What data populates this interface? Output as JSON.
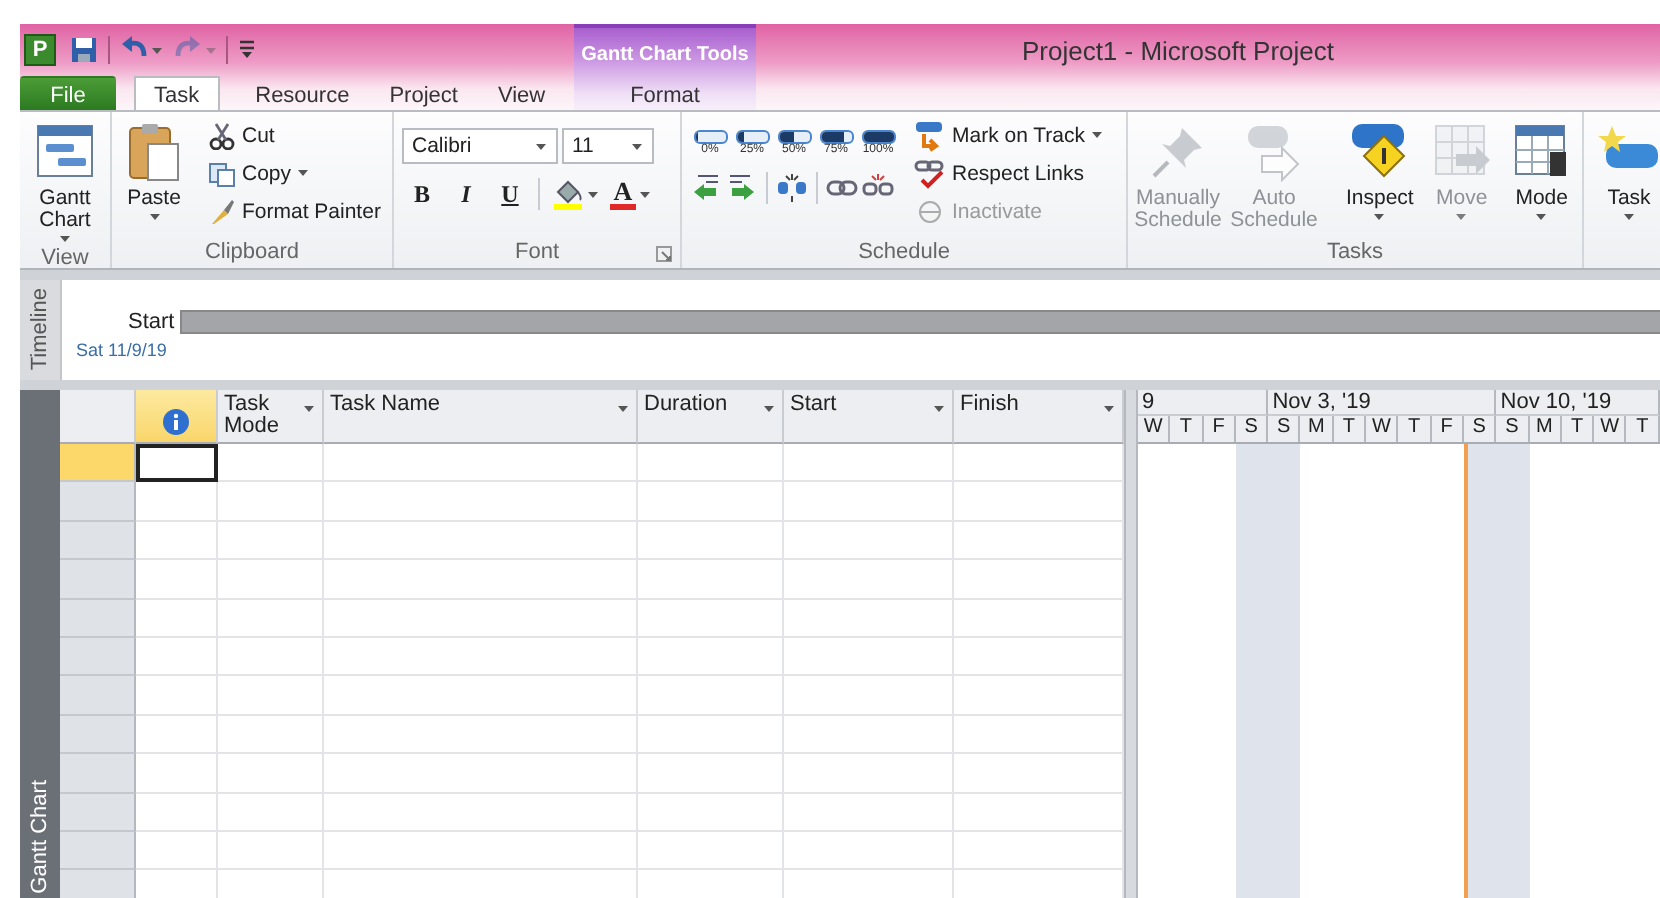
{
  "title_bar": {
    "app_icon": "P",
    "title": "Project1  -  Microsoft Project",
    "context_group": "Gantt Chart Tools"
  },
  "quick_access": [
    {
      "kind": "save",
      "disabled": false
    },
    {
      "kind": "undo",
      "disabled": false
    },
    {
      "kind": "redo",
      "disabled": true
    },
    {
      "kind": "customize",
      "disabled": false
    }
  ],
  "tabs": [
    {
      "label": "File",
      "kind": "file",
      "selected": false
    },
    {
      "label": "Task",
      "kind": "normal",
      "selected": true
    },
    {
      "label": "Resource",
      "kind": "normal",
      "selected": false
    },
    {
      "label": "Project",
      "kind": "normal",
      "selected": false
    },
    {
      "label": "View",
      "kind": "normal",
      "selected": false
    },
    {
      "label": "Format",
      "kind": "context",
      "selected": false
    }
  ],
  "ribbon_groups": [
    {
      "kind": "view",
      "label": "View",
      "buttons": [
        {
          "label": "Gantt Chart",
          "disabled": false,
          "dropdown": true
        }
      ]
    },
    {
      "kind": "clipboard",
      "label": "Clipboard",
      "large": {
        "label": "Paste",
        "disabled": false,
        "dropdown": true
      },
      "small": [
        {
          "label": "Cut",
          "disabled": false,
          "dropdown": false
        },
        {
          "label": "Copy",
          "disabled": false,
          "dropdown": true
        },
        {
          "label": "Format Painter",
          "disabled": false,
          "dropdown": false
        }
      ]
    },
    {
      "kind": "font",
      "label": "Font",
      "font_name": "Calibri",
      "font_size": "11",
      "styles": [
        {
          "label": "B",
          "kind": "bold"
        },
        {
          "label": "I",
          "kind": "italic"
        },
        {
          "label": "U",
          "kind": "underline"
        }
      ],
      "color_buttons": [
        {
          "kind": "highlight",
          "color": "#ffff00"
        },
        {
          "kind": "font_color",
          "label": "A",
          "color": "#e02828"
        }
      ]
    },
    {
      "kind": "schedule",
      "label": "Schedule",
      "percent_buttons": [
        {
          "label": "0%",
          "level": 0
        },
        {
          "label": "25%",
          "level": 0.25
        },
        {
          "label": "50%",
          "level": 0.5
        },
        {
          "label": "75%",
          "level": 0.75
        },
        {
          "label": "100%",
          "level": 1
        }
      ],
      "tools": [
        {
          "kind": "outdent"
        },
        {
          "kind": "indent"
        },
        {
          "kind": "separator"
        },
        {
          "kind": "split"
        },
        {
          "kind": "separator"
        },
        {
          "kind": "link"
        },
        {
          "kind": "unlink"
        }
      ],
      "commands": [
        {
          "label": "Mark on Track",
          "disabled": false,
          "dropdown": true
        },
        {
          "label": "Respect Links",
          "disabled": false,
          "dropdown": false
        },
        {
          "label": "Inactivate",
          "disabled": true,
          "dropdown": false
        }
      ]
    },
    {
      "kind": "tasks",
      "label": "Tasks",
      "buttons": [
        {
          "label": "Manually Schedule",
          "disabled": true,
          "dropdown": false
        },
        {
          "label": "Auto Schedule",
          "disabled": true,
          "dropdown": false
        },
        {
          "label": "Inspect",
          "disabled": false,
          "dropdown": true
        },
        {
          "label": "Move",
          "disabled": true,
          "dropdown": true
        },
        {
          "label": "Mode",
          "disabled": false,
          "dropdown": true
        }
      ]
    },
    {
      "kind": "insert",
      "buttons": [
        {
          "label": "Task",
          "disabled": false,
          "dropdown": true
        }
      ]
    }
  ],
  "timeline": {
    "side_label": "Timeline",
    "start_label": "Start",
    "start_date": "Sat 11/9/19"
  },
  "gantt": {
    "side_label": "Gantt Chart",
    "columns": [
      {
        "kind": "indicators"
      },
      {
        "kind": "text",
        "label": "Task Mode"
      },
      {
        "kind": "text",
        "label": "Task Name"
      },
      {
        "kind": "text",
        "label": "Duration"
      },
      {
        "kind": "text",
        "label": "Start"
      },
      {
        "kind": "text",
        "label": "Finish"
      }
    ],
    "rows": [
      {
        "selected": true
      },
      {
        "selected": false
      },
      {
        "selected": false
      },
      {
        "selected": false
      },
      {
        "selected": false
      },
      {
        "selected": false
      },
      {
        "selected": false
      },
      {
        "selected": false
      },
      {
        "selected": false
      },
      {
        "selected": false
      },
      {
        "selected": false
      },
      {
        "selected": false
      }
    ],
    "timescale": [
      {
        "label": "9",
        "days": [
          {
            "label": "W",
            "nonworking": false,
            "today": false
          },
          {
            "label": "T",
            "nonworking": false,
            "today": false
          },
          {
            "label": "F",
            "nonworking": false,
            "today": false
          },
          {
            "label": "S",
            "nonworking": true,
            "today": false
          }
        ]
      },
      {
        "label": "Nov 3, '19",
        "days": [
          {
            "label": "S",
            "nonworking": true,
            "today": false
          },
          {
            "label": "M",
            "nonworking": false,
            "today": false
          },
          {
            "label": "T",
            "nonworking": false,
            "today": false
          },
          {
            "label": "W",
            "nonworking": false,
            "today": false
          },
          {
            "label": "T",
            "nonworking": false,
            "today": false
          },
          {
            "label": "F",
            "nonworking": false,
            "today": false
          },
          {
            "label": "S",
            "nonworking": true,
            "today": true
          }
        ]
      },
      {
        "label": "Nov 10, '19",
        "days": [
          {
            "label": "S",
            "nonworking": true,
            "today": false
          },
          {
            "label": "M",
            "nonworking": false,
            "today": false
          },
          {
            "label": "T",
            "nonworking": false,
            "today": false
          },
          {
            "label": "W",
            "nonworking": false,
            "today": false
          },
          {
            "label": "T",
            "nonworking": false,
            "today": false
          }
        ]
      }
    ]
  }
}
